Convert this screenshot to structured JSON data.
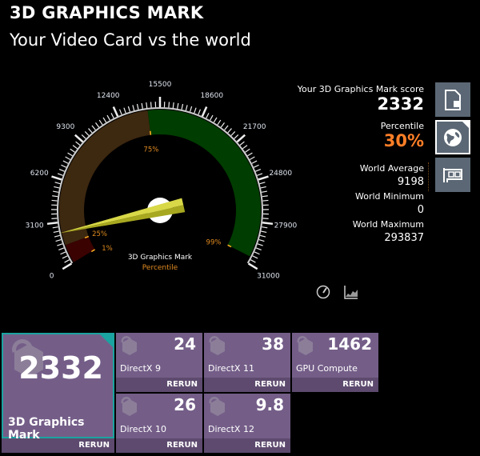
{
  "header": {
    "title": "3D GRAPHICS MARK",
    "subtitle": "Your Video Card vs the world"
  },
  "gauge": {
    "min": 0,
    "max": 31000,
    "value": 2332,
    "tick_labels": [
      "0",
      "3100",
      "6200",
      "9300",
      "12400",
      "15500",
      "18600",
      "21700",
      "24800",
      "27900",
      "31000"
    ],
    "bands": [
      {
        "from": 0,
        "to": 1400,
        "color": "#3a0200"
      },
      {
        "from": 1400,
        "to": 14600,
        "color": "#3d2810"
      },
      {
        "from": 14600,
        "to": 30500,
        "color": "#003d00"
      }
    ],
    "percentile_markers": [
      {
        "label": "1%",
        "value": 0
      },
      {
        "label": "25%",
        "value": 1400
      },
      {
        "label": "75%",
        "value": 14600
      },
      {
        "label": "99%",
        "value": 30500
      }
    ],
    "caption": "3D Graphics Mark",
    "caption2": "Percentile",
    "needle_color": "#d8d848"
  },
  "stats": {
    "score_label": "Your 3D Graphics Mark score",
    "score": "2332",
    "percentile_label": "Percentile",
    "percentile": "30%",
    "avg_label": "World Average",
    "avg": "9198",
    "min_label": "World Minimum",
    "min": "0",
    "max_label": "World Maximum",
    "max": "293837"
  },
  "side_buttons": [
    {
      "icon": "document-icon",
      "selected": false
    },
    {
      "icon": "globe-icon",
      "selected": true
    },
    {
      "icon": "graphics-card-icon",
      "selected": false
    }
  ],
  "bottom_icons": [
    "speedometer-icon",
    "chart-icon"
  ],
  "tiles": {
    "main": {
      "value": "2332",
      "label": "3D Graphics Mark",
      "rerun": "RERUN"
    },
    "items": [
      {
        "value": "24",
        "label": "DirectX 9",
        "rerun": "RERUN"
      },
      {
        "value": "38",
        "label": "DirectX 11",
        "rerun": "RERUN"
      },
      {
        "value": "1462",
        "label": "GPU Compute",
        "rerun": "RERUN"
      },
      {
        "value": "26",
        "label": "DirectX 10",
        "rerun": "RERUN"
      },
      {
        "value": "9.8",
        "label": "DirectX 12",
        "rerun": "RERUN"
      }
    ]
  },
  "colors": {
    "accent": "#1aa3a0",
    "tile": "#745e88",
    "rerun_bar": "#5d4a6e",
    "percentile": "#ff7f27"
  }
}
